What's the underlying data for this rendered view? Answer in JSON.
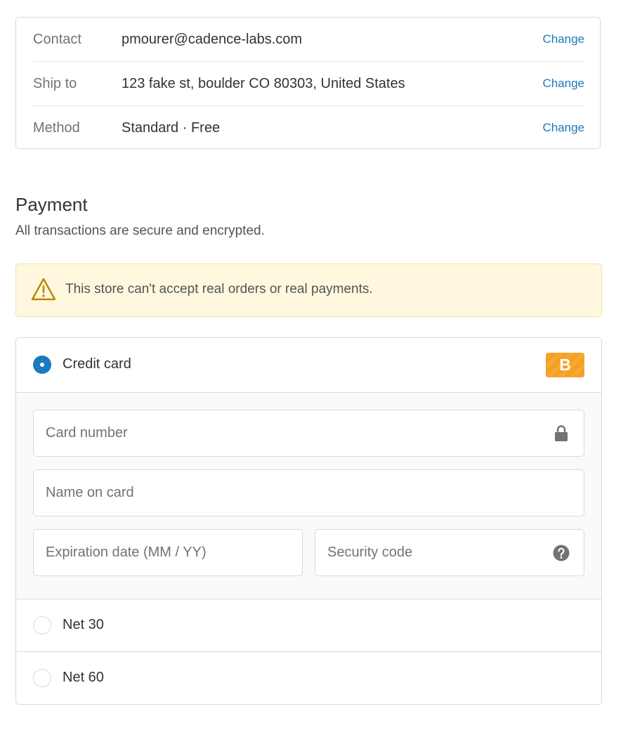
{
  "summary": {
    "rows": [
      {
        "label": "Contact",
        "value": "pmourer@cadence-labs.com",
        "action": "Change"
      },
      {
        "label": "Ship to",
        "value": "123 fake st, boulder CO 80303, United States",
        "action": "Change"
      },
      {
        "label": "Method",
        "value": "Standard · Free",
        "action": "Change"
      }
    ]
  },
  "payment": {
    "title": "Payment",
    "subtitle": "All transactions are secure and encrypted.",
    "notice": "This store can't accept real orders or real payments.",
    "methods": [
      {
        "label": "Credit card",
        "selected": true,
        "brand_badge": "B"
      },
      {
        "label": "Net 30",
        "selected": false
      },
      {
        "label": "Net 60",
        "selected": false
      }
    ],
    "fields": {
      "card_number_placeholder": "Card number",
      "name_placeholder": "Name on card",
      "expiry_placeholder": "Expiration date (MM / YY)",
      "security_placeholder": "Security code"
    }
  },
  "colors": {
    "accent": "#197bbd",
    "notice_bg": "#fff8de",
    "warning_icon": "#b88600",
    "brand_badge": "#f7a830"
  },
  "icons": [
    "warning-icon",
    "lock-icon",
    "help-icon"
  ]
}
